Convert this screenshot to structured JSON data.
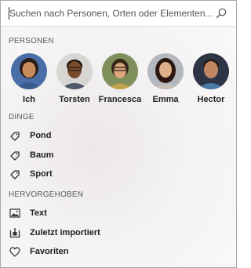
{
  "search": {
    "placeholder": "Suchen nach Personen, Orten oder Elementen..."
  },
  "sections": {
    "people": "PERSONEN",
    "things": "DINGE",
    "featured": "HERVORGEHOBEN"
  },
  "people": [
    {
      "name": "Ich",
      "bg": "#4a6fa8",
      "skin": "#c98a5e",
      "hair": "#2a1c14",
      "shirt": "#3a5d8f"
    },
    {
      "name": "Torsten",
      "bg": "#d8d6d2",
      "skin": "#7a4a2c",
      "hair": "#1a120c",
      "shirt": "#4f5a68"
    },
    {
      "name": "Francesca",
      "bg": "#7e8f5c",
      "skin": "#d9a679",
      "hair": "#3a2618",
      "shirt": "#c2a44a"
    },
    {
      "name": "Emma",
      "bg": "#b3b7be",
      "skin": "#e0b08a",
      "hair": "#2a1810",
      "shirt": "#c8c2b4"
    },
    {
      "name": "Hector",
      "bg": "#2d3446",
      "skin": "#c08662",
      "hair": "#241812",
      "shirt": "#4a7aa6"
    }
  ],
  "things": [
    {
      "label": "Pond",
      "icon": "tag-icon"
    },
    {
      "label": "Baum",
      "icon": "tag-icon"
    },
    {
      "label": "Sport",
      "icon": "tag-icon"
    }
  ],
  "featured": [
    {
      "label": "Text",
      "icon": "image-icon"
    },
    {
      "label": "Zuletzt importiert",
      "icon": "import-icon"
    },
    {
      "label": "Favoriten",
      "icon": "heart-icon"
    }
  ]
}
